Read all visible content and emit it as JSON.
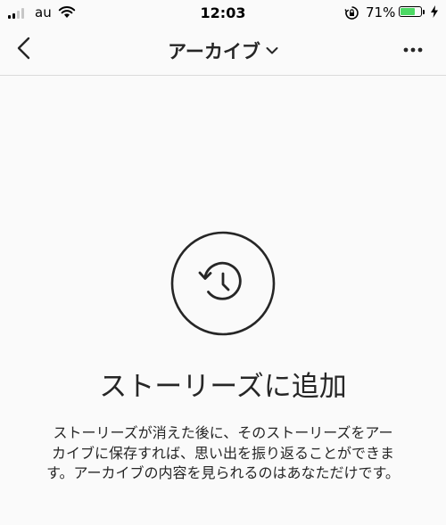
{
  "status_bar": {
    "carrier": "au",
    "time": "12:03",
    "battery_percent": "71%",
    "battery_level": 0.71,
    "icons": [
      "signal-icon",
      "wifi-icon",
      "orientation-lock-icon",
      "battery-icon",
      "charging-bolt-icon"
    ]
  },
  "header": {
    "title": "アーカイブ",
    "icons": [
      "back-chevron-icon",
      "chevron-down-icon",
      "more-dots-icon"
    ]
  },
  "empty_state": {
    "icon": "history-clock-icon",
    "title": "ストーリーズに追加",
    "description": "ストーリーズが消えた後に、そのストーリーズをアーカイブに保存すれば、思い出を振り返ることができます。アーカイブの内容を見られるのはあなただけです。"
  },
  "colors": {
    "background": "#fafafa",
    "text": "#262626",
    "divider": "#dbdbdb",
    "battery_fill": "#4cd964"
  }
}
